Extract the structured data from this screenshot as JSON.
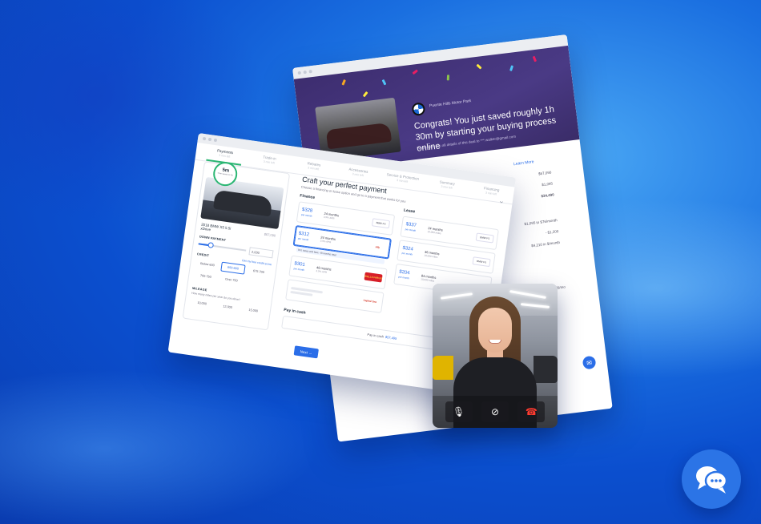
{
  "colors": {
    "accent": "#2b6ee8",
    "step_active": "#2bb673",
    "email_header": "#3d2d6f",
    "chat_fab": "#2b74e6",
    "end_call": "#ff3b30"
  },
  "email": {
    "dealer": "Puente Hills Motor Park",
    "headline": "Congrats! You just saved roughly 1h 30m by starting your buying process online",
    "subtext": "We've sent you all details of this deal to ***.walker@gmail.com",
    "link": "Learn More",
    "values": [
      "$67,090",
      "$1,095",
      "$34,490",
      "$1,095 to $76/month",
      "- $1,200",
      "$4,210 in $/month",
      "$76/mo"
    ]
  },
  "payment": {
    "steps": [
      {
        "label": "Payments",
        "sub": "3 min left"
      },
      {
        "label": "Trade-in",
        "sub": "3 min left"
      },
      {
        "label": "Rebates",
        "sub": "3 min left"
      },
      {
        "label": "Accessories",
        "sub": "3 min left"
      },
      {
        "label": "Service & Protection",
        "sub": "3 min left"
      },
      {
        "label": "Summary",
        "sub": "3 min left"
      },
      {
        "label": "Financing",
        "sub": "3 min left"
      }
    ],
    "timer": {
      "value": "5m",
      "label": "Time saved so far"
    },
    "car": {
      "name": "2018 BMW X5 5.5i xDrive",
      "price": "$67,090"
    },
    "down_payment": {
      "label": "DOWN PAYMENT",
      "value": "2,000",
      "level": 0.25
    },
    "credit": {
      "label": "CREDIT",
      "link": "Get my free credit score",
      "options": [
        "Below 600",
        "600-660",
        "675-700",
        "700-750",
        "Over 750"
      ],
      "selected": "600-660"
    },
    "mileage": {
      "label": "MILEAGE",
      "question": "How many miles per year do you drive?",
      "options": [
        "10,000",
        "12,000",
        "15,000"
      ]
    },
    "title": "Craft your perfect payment",
    "description": "Choose a financing or lease option and go to a payment that works for you",
    "finance": {
      "title": "Finance",
      "options": [
        {
          "price": "$328",
          "unit": "per month",
          "term": "24 months",
          "apr": "3.9% APR",
          "lender": "BMW FS"
        },
        {
          "price": "$312",
          "unit": "per month",
          "term": "24 months",
          "apr": "3.9% APR",
          "lender": "Ally"
        },
        {
          "price": "$301",
          "unit": "per month",
          "term": "48 months",
          "apr": "3.9% APR",
          "lender": "WELLS FARGO"
        }
      ],
      "note": "Incl. taxes and fees. 48 months total",
      "extra_lender": "Capital One"
    },
    "lease": {
      "title": "Lease",
      "options": [
        {
          "price": "$337",
          "unit": "per month",
          "term": "24 months",
          "apr": "10,000 miles",
          "lender": "BMW FS"
        },
        {
          "price": "$324",
          "unit": "per month",
          "term": "36 months",
          "apr": "10,000 miles",
          "lender": "BMW FS"
        },
        {
          "price": "$204",
          "unit": "per month",
          "term": "84 months",
          "apr": "10,000 miles",
          "lender": ""
        }
      ]
    },
    "cash": {
      "title": "Pay in cash",
      "label": "Pay in cash",
      "amount": "$57,495"
    },
    "next": "Next →"
  },
  "video_call": {
    "controls": [
      {
        "icon": "microphone-icon",
        "glyph": "🎙"
      },
      {
        "icon": "camera-off-icon",
        "glyph": "⊘"
      },
      {
        "icon": "end-call-icon",
        "glyph": "☎"
      }
    ]
  },
  "chat": {
    "icon": "chat-bubbles-icon"
  }
}
